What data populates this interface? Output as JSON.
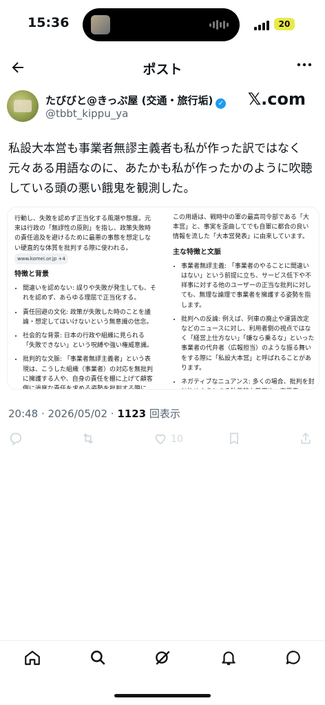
{
  "status": {
    "time": "15:36",
    "battery": "20"
  },
  "header": {
    "title": "ポスト"
  },
  "author": {
    "name": "たびびと@きっぷ屋 (交通・旅行垢)",
    "handle": "@tbbt_kippu_ya",
    "source": "𝕏.com"
  },
  "post": {
    "text": "私設大本営も事業者無謬主義者も私が作った訳ではなく元々ある用語なのに、あたかも私が作ったかのように吹聴している頭の悪い餓鬼を観測した。"
  },
  "image": {
    "left_intro": "行動し、失敗を認めず正当化する風潮や態度。元来は行政の「無謬性の原則」を指し、政策失敗時の責任追及を避けるために最悪の事態を想定しない硬直的な体質を批判する際に使われる。",
    "left_chip": "www.komei.or.jp +4",
    "left_heading": "特徴と背景",
    "left_items": [
      "間違いを認めない: 誤りや失敗が発生しても、それを認めず、あらゆる理屈で正当化する。",
      "責任回避の文化: 政策が失敗した時のことを議論・想定してはいけないという無意識の信念。",
      "社会的な背景: 日本の行政や組織に見られる「失敗できない」という呪縛や強い権威意識。",
      "批判的な文脈: 「事業者無謬主義者」という表現は、こうした組織（事業者）の対応を無批判に擁護する人や、自身の責任を棚に上げて顧客側に過度な責任を求める姿勢を批判する際にSNSなどで用いられる。"
    ],
    "right_intro": "この用語は、戦時中の軍の最高司令部である「大本営」と、事実を歪曲してでも自軍に都合の良い情報を流した「大本営発表」に由来しています。",
    "right_heading": "主な特徴と文脈",
    "right_items": [
      "事業者無謬主義: 「事業者のやることに間違いはない」という前提に立ち、サービス低下や不祥事に対する他のユーザーの正当な批判に対しても、無理な論理で事業者を擁護する姿勢を指します。",
      "批判への反論: 例えば、列車の廃止や運賃改定などのニュースに対し、利用者側の視点ではなく「経営上仕方ない」「嫌なら乗るな」といった事業者の代弁者（広報担当）のような振る舞いをする際に「私設大本営」と呼ばれることがあります。",
      "ネガティブなニュアンス: 多くの場合、批判を封じ込めようとする独善的な態度や、事業者へ"
    ]
  },
  "meta": {
    "time": "20:48",
    "date": "2026/05/02",
    "views": "1123",
    "views_label": "回表示"
  },
  "actions": {
    "likes": "10"
  },
  "colors": {
    "verified": "#1d9bf0",
    "muted": "#536471",
    "action": "#cfd9de"
  },
  "icons": [
    "back-arrow-icon",
    "more-icon",
    "reply-icon",
    "repost-icon",
    "like-icon",
    "bookmark-icon",
    "share-icon",
    "home-icon",
    "search-icon",
    "grok-icon",
    "notifications-icon",
    "messages-icon"
  ]
}
